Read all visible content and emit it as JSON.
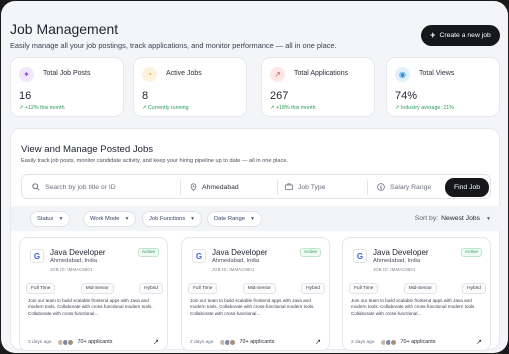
{
  "header": {
    "title": "Job Management",
    "subtitle": "Easily manage all your job postings, track applications, and monitor performance — all in one place.",
    "create_label": "Create a new job"
  },
  "stats": [
    {
      "icon": "sparkle-icon",
      "icon_glyph": "✦",
      "icon_color": "#8a4fd6",
      "icon_bg": "#f1e6fb",
      "label": "Total Job Posts",
      "value": "16",
      "trend": "↗ +12% this month"
    },
    {
      "icon": "clock-icon",
      "icon_glyph": "◔",
      "icon_color": "#d59a1c",
      "icon_bg": "#fdf3dd",
      "label": "Active Jobs",
      "value": "8",
      "trend": "↗ Currently running"
    },
    {
      "icon": "trend-chart-icon",
      "icon_glyph": "↗",
      "icon_color": "#e0505b",
      "icon_bg": "#fde6e8",
      "label": "Total Applications",
      "value": "267",
      "trend": "↗ +18% this month"
    },
    {
      "icon": "eye-icon",
      "icon_glyph": "◉",
      "icon_color": "#2e8fd8",
      "icon_bg": "#e1f1fc",
      "label": "Total Views",
      "value": "74%",
      "trend": "↗ Industry average: 21%"
    }
  ],
  "panel": {
    "title": "View and Manage Posted Jobs",
    "subtitle": "Easily track job posts, monitor candidate activity, and keep your hiring pipeline up to date — all in one place."
  },
  "search": {
    "keyword_placeholder": "Search by job title or ID",
    "location_value": "Ahmedabad",
    "job_type_placeholder": "Job Type",
    "salary_placeholder": "Salary Range",
    "find_label": "Find Job"
  },
  "filters": {
    "chips": [
      "Status",
      "Work Mode",
      "Job Functions",
      "Date Range"
    ],
    "sort_label": "Sort by:",
    "sort_value": "Newest Jobs"
  },
  "jobs": [
    {
      "logo": "G",
      "title": "Java Developer",
      "location": "Ahmedabad, India",
      "job_id": "JOB ID: IMMAC8801",
      "status": "Active",
      "tags": [
        "Full Time",
        "Mid-Senior",
        "Hybrid"
      ],
      "description": "Join our team to build scalable frontend apps with Java and modern tools. Collaborate with cross-functional modern tools. Collaborate with cross-functional...",
      "posted": "2 days ago",
      "applicants": "70+ applicants"
    },
    {
      "logo": "G",
      "title": "Java Developer",
      "location": "Ahmedabad, India",
      "job_id": "JOB ID: IMMAC8801",
      "status": "Active",
      "tags": [
        "Full Time",
        "Mid-Senior",
        "Hybrid"
      ],
      "description": "Join our team to build scalable frontend apps with Java and modern tools. Collaborate with cross-functional modern tools. Collaborate with cross-functional...",
      "posted": "2 days ago",
      "applicants": "70+ applicants"
    },
    {
      "logo": "G",
      "title": "Java Developer",
      "location": "Ahmedabad, India",
      "job_id": "JOB ID: IMMAC8801",
      "status": "Active",
      "tags": [
        "Full Time",
        "Mid-Senior",
        "Hybrid"
      ],
      "description": "Join our team to build scalable frontend apps with Java and modern tools. Collaborate with cross-functional modern tools. Collaborate with cross-functional...",
      "posted": "2 days ago",
      "applicants": "70+ applicants"
    }
  ],
  "colors": {
    "accent_dark": "#15171c",
    "success": "#2a9a55",
    "avatar_a": "#c9b8a6",
    "avatar_b": "#7c8aa3"
  }
}
